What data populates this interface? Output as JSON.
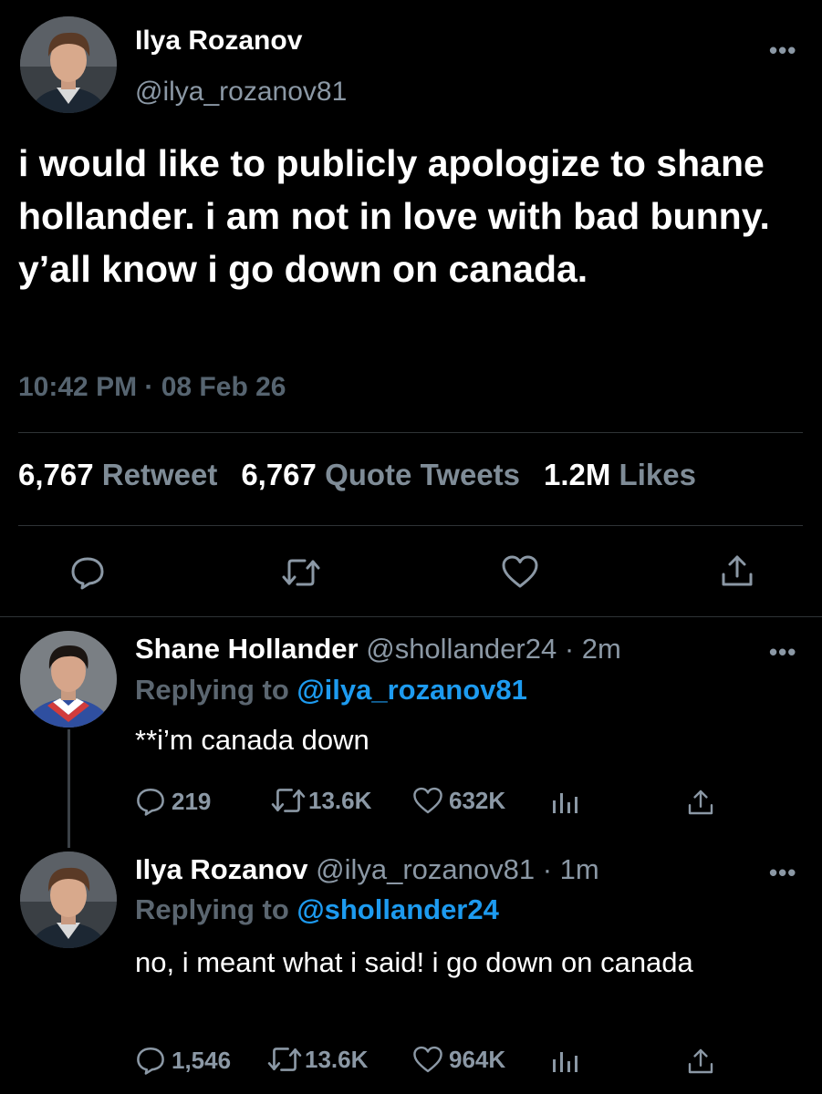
{
  "main_tweet": {
    "author_name": "Ilya Rozanov",
    "author_handle": "@ilya_rozanov81",
    "text": "i would like to publicly apologize to shane hollander. i am not in love with bad bunny. y’all know i go down on canada.",
    "timestamp": "10:42 PM · 08 Feb 26",
    "stats": {
      "retweets": "6,767",
      "retweets_label": "Retweet",
      "quotes": "6,767",
      "quotes_label": "Quote Tweets",
      "likes": "1.2M",
      "likes_label": "Likes"
    },
    "more": "•••"
  },
  "replies": [
    {
      "author_name": "Shane Hollander",
      "meta": " @shollander24 · 2m",
      "replying_prefix": "Replying to ",
      "replying_to": "@ilya_rozanov81",
      "text": "**i’m canada down",
      "counts": {
        "replies": "219",
        "retweets": "13.6K",
        "likes": "632K"
      },
      "more": "•••"
    },
    {
      "author_name": "Ilya Rozanov",
      "meta": " @ilya_rozanov81 · 1m",
      "replying_prefix": "Replying to ",
      "replying_to": "@shollander24",
      "text": "no, i meant what i said! i go down on canada",
      "counts": {
        "replies": "1,546",
        "retweets": "13.6K",
        "likes": "964K"
      },
      "more": "•••"
    }
  ],
  "icons": {
    "reply": "reply-bubble-icon",
    "retweet": "retweet-icon",
    "like": "heart-icon",
    "share": "share-icon",
    "analytics": "analytics-icon",
    "more": "more-icon"
  },
  "colors": {
    "background": "#000000",
    "text_primary": "#ffffff",
    "text_secondary": "#8b98a5",
    "mention": "#1d9bf0",
    "divider": "#2f3336"
  }
}
